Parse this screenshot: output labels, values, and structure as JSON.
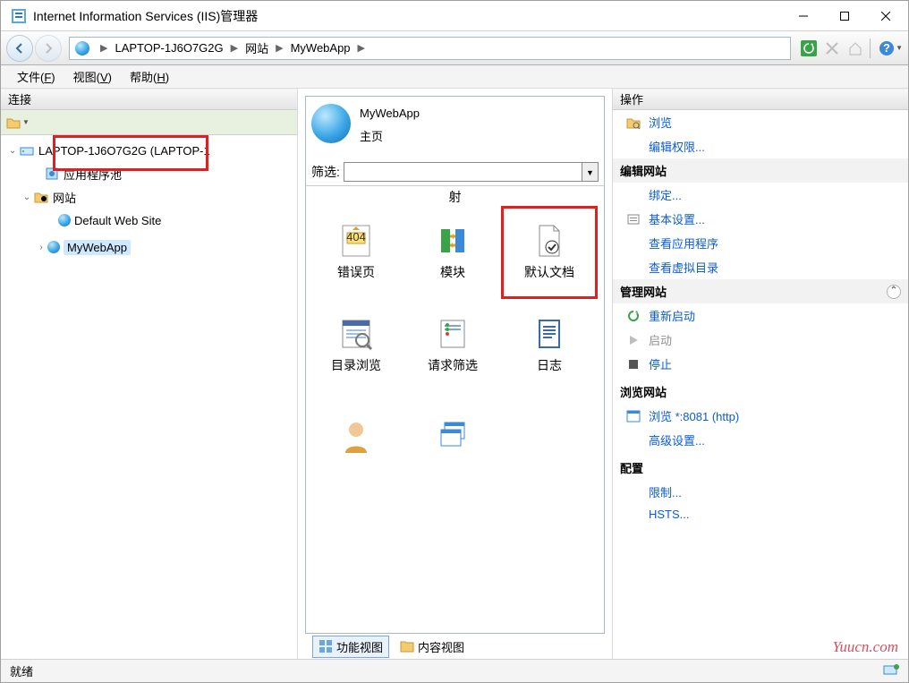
{
  "window": {
    "title": "Internet Information Services (IIS)管理器"
  },
  "breadcrumb": {
    "host": "LAPTOP-1J6O7G2G",
    "level1": "网站",
    "level2": "MyWebApp"
  },
  "menu": {
    "file": "文件(F)",
    "view": "视图(V)",
    "help": "帮助(H)"
  },
  "left": {
    "header": "连接",
    "tree": {
      "root": "LAPTOP-1J6O7G2G (LAPTOP-1",
      "pool": "应用程序池",
      "sites": "网站",
      "default_site": "Default Web Site",
      "mywebapp": "MyWebApp"
    }
  },
  "center": {
    "title_line1": "MyWebApp",
    "title_line2": "主页",
    "filter_label": "筛选:",
    "top_clipped": "射",
    "features": {
      "error": "错误页",
      "modules": "模块",
      "default_doc": "默认文档",
      "dir_browse": "目录浏览",
      "req_filter": "请求筛选",
      "logs": "日志"
    },
    "tabs": {
      "features": "功能视图",
      "content": "内容视图"
    }
  },
  "right": {
    "header": "操作",
    "browse": "浏览",
    "edit_perm": "编辑权限...",
    "sect_edit_site": "编辑网站",
    "bindings": "绑定...",
    "basic": "基本设置...",
    "view_apps": "查看应用程序",
    "view_vdirs": "查看虚拟目录",
    "sect_manage": "管理网站",
    "restart": "重新启动",
    "start": "启动",
    "stop": "停止",
    "sect_browse": "浏览网站",
    "browse_port": "浏览 *:8081 (http)",
    "advanced": "高级设置...",
    "sect_config": "配置",
    "limits": "限制...",
    "hsts": "HSTS..."
  },
  "status": {
    "ready": "就绪"
  },
  "watermark": "Yuucn.com"
}
